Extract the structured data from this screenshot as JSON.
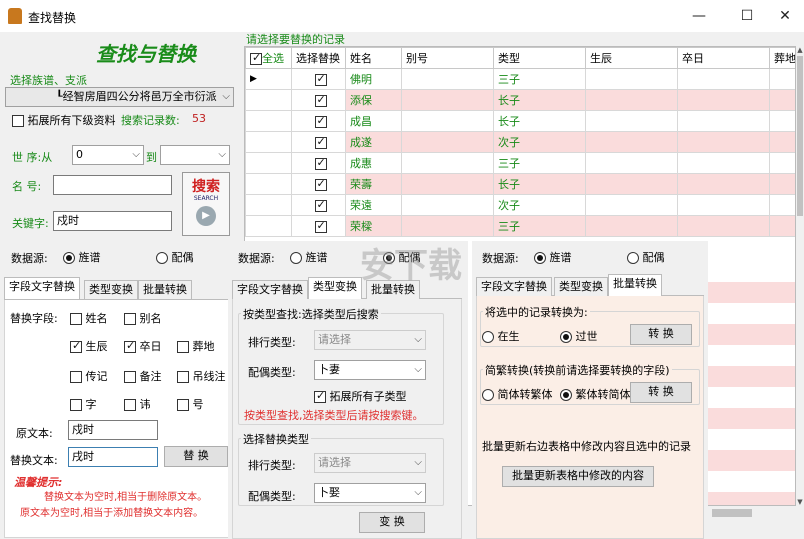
{
  "window": {
    "title": "查找替换",
    "minimize": "—",
    "maximize": "☐",
    "close": "✕"
  },
  "left": {
    "big_title": "查找与替换",
    "clan_label": "选择族谱、支派",
    "clan_value": "┖经智房眉四公分将邑万全市衍派",
    "expand_label": "拓展所有下级资料",
    "count_label": "搜索记录数:",
    "count_value": "53",
    "gen_label": "世  序:从",
    "gen_from": "0",
    "gen_to_label": "到",
    "gen_to": "",
    "name_label": "名  号:",
    "name_value": "",
    "keyword_label": "关键字:",
    "keyword_value": "戍时",
    "search_btn": "搜索",
    "search_sub": "SEARCH",
    "source_label": "数据源:",
    "source_opt1": "旌谱",
    "source_opt2": "配偶",
    "tabs": [
      "字段文字替换",
      "类型变换",
      "批量转换"
    ],
    "fields_label": "替换字段:",
    "fields": [
      {
        "label": "姓名",
        "checked": false
      },
      {
        "label": "别名",
        "checked": false
      },
      {
        "label": "生辰",
        "checked": true
      },
      {
        "label": "卒日",
        "checked": true
      },
      {
        "label": "葬地",
        "checked": false
      },
      {
        "label": "传记",
        "checked": false
      },
      {
        "label": "备注",
        "checked": false
      },
      {
        "label": "吊线注",
        "checked": false
      },
      {
        "label": "字",
        "checked": false
      },
      {
        "label": "讳",
        "checked": false
      },
      {
        "label": "号",
        "checked": false
      }
    ],
    "orig_label": "原文本:",
    "orig_value": "戍时",
    "repl_label": "替换文本:",
    "repl_value": "戌时",
    "replace_btn": "替 换",
    "tip_title": "温馨提示:",
    "tip1": "替换文本为空时,相当于删除原文本。",
    "tip2": "原文本为空时,相当于添加替换文本内容。"
  },
  "grid": {
    "title": "请选择要替换的记录",
    "select_all": "全选",
    "columns": [
      "选择替换",
      "姓名",
      "别号",
      "类型",
      "生辰",
      "卒日",
      "葬地"
    ],
    "rows": [
      {
        "name": "佛明",
        "type": "三子"
      },
      {
        "name": "添保",
        "type": "长子"
      },
      {
        "name": "成昌",
        "type": "长子"
      },
      {
        "name": "成遂",
        "type": "次子"
      },
      {
        "name": "成惠",
        "type": "三子"
      },
      {
        "name": "荣壽",
        "type": "长子"
      },
      {
        "name": "荣遠",
        "type": "次子"
      },
      {
        "name": "荣樑",
        "type": "三子"
      }
    ]
  },
  "mid": {
    "source_label": "数据源:",
    "source_opt1": "旌谱",
    "source_opt2": "配偶",
    "tabs": [
      "字段文字替换",
      "类型变换",
      "批量转换"
    ],
    "grp1_title": "按类型查找:选择类型后搜索",
    "rank_label": "排行类型:",
    "rank_value": "请选择",
    "spouse_label": "配偶类型:",
    "spouse_value": "卜妻",
    "expand_label": "拓展所有子类型",
    "hint": "按类型查找,选择类型后请按搜索键。",
    "grp2_title": "选择替换类型",
    "rank2_value": "请选择",
    "spouse2_value": "卜娶",
    "convert_btn": "变 换"
  },
  "right": {
    "source_label": "数据源:",
    "source_opt1": "旌谱",
    "source_opt2": "配偶",
    "tabs": [
      "字段文字替换",
      "类型变换",
      "批量转换"
    ],
    "grp1_title": "将选中的记录转换为:",
    "alive": "在生",
    "passed": "过世",
    "convert_btn1": "转 换",
    "grp2_title": "简繁转换(转换前请选择要转换的字段)",
    "s2t": "简体转繁体",
    "t2s": "繁体转简体",
    "convert_btn2": "转 换",
    "batch_desc": "批量更新右边表格中修改内容且选中的记录",
    "batch_btn": "批量更新表格中修改的内容"
  },
  "watermark": "安下载"
}
